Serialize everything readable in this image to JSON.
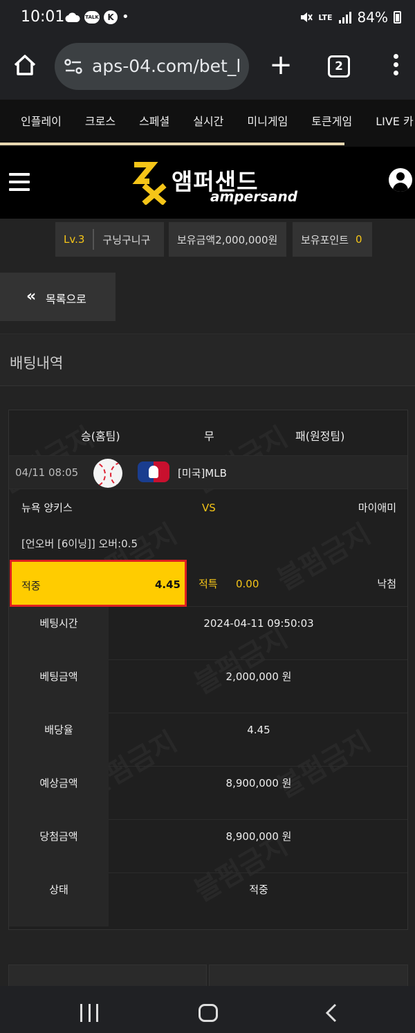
{
  "status_bar": {
    "time": "10:01",
    "battery": "84%",
    "network": "LTE",
    "icons": [
      "cloud-icon",
      "talk-icon",
      "k-icon",
      "mute-icon",
      "signal-icon",
      "battery-icon"
    ]
  },
  "browser": {
    "url": "aps-04.com/bet_l",
    "tab_count": "2"
  },
  "site_nav": {
    "items": [
      "인플레이",
      "크로스",
      "스페셜",
      "실시간",
      "미니게임",
      "토큰게임",
      "LIVE 카"
    ]
  },
  "brand": {
    "name": "앰퍼샌드",
    "sub": "ampersand",
    "accent": "#f5c518"
  },
  "user_info": {
    "level": "Lv.3",
    "username": "구닝구니구",
    "balance_label": "보유금액",
    "balance": "2,000,000원",
    "points_label": "보유포인트",
    "points": "0"
  },
  "back_button": {
    "label": "목록으로"
  },
  "section_title": "배팅내역",
  "bet": {
    "header": {
      "win": "승(홈팀)",
      "draw": "무",
      "lose": "패(원정팀)"
    },
    "date": "04/11 08:05",
    "league": "[미국]MLB",
    "home_team": "뉴욕 양키스",
    "vs": "VS",
    "away_team": "마이애미",
    "market": "[언오버 [6이닝]] 오버:0.5",
    "selection_label": "적중",
    "selection_odds": "4.45",
    "special_label": "적특",
    "special_value": "0.00",
    "result": "낙첨",
    "details": [
      {
        "label": "베팅시간",
        "value": "2024-04-11 09:50:03"
      },
      {
        "label": "베팅금액",
        "value": "2,000,000 원"
      },
      {
        "label": "배당율",
        "value": "4.45"
      },
      {
        "label": "예상금액",
        "value": "8,900,000 원"
      },
      {
        "label": "당첨금액",
        "value": "8,900,000 원"
      },
      {
        "label": "상태",
        "value": "적중"
      }
    ]
  },
  "watermark_text": "블펌금지"
}
